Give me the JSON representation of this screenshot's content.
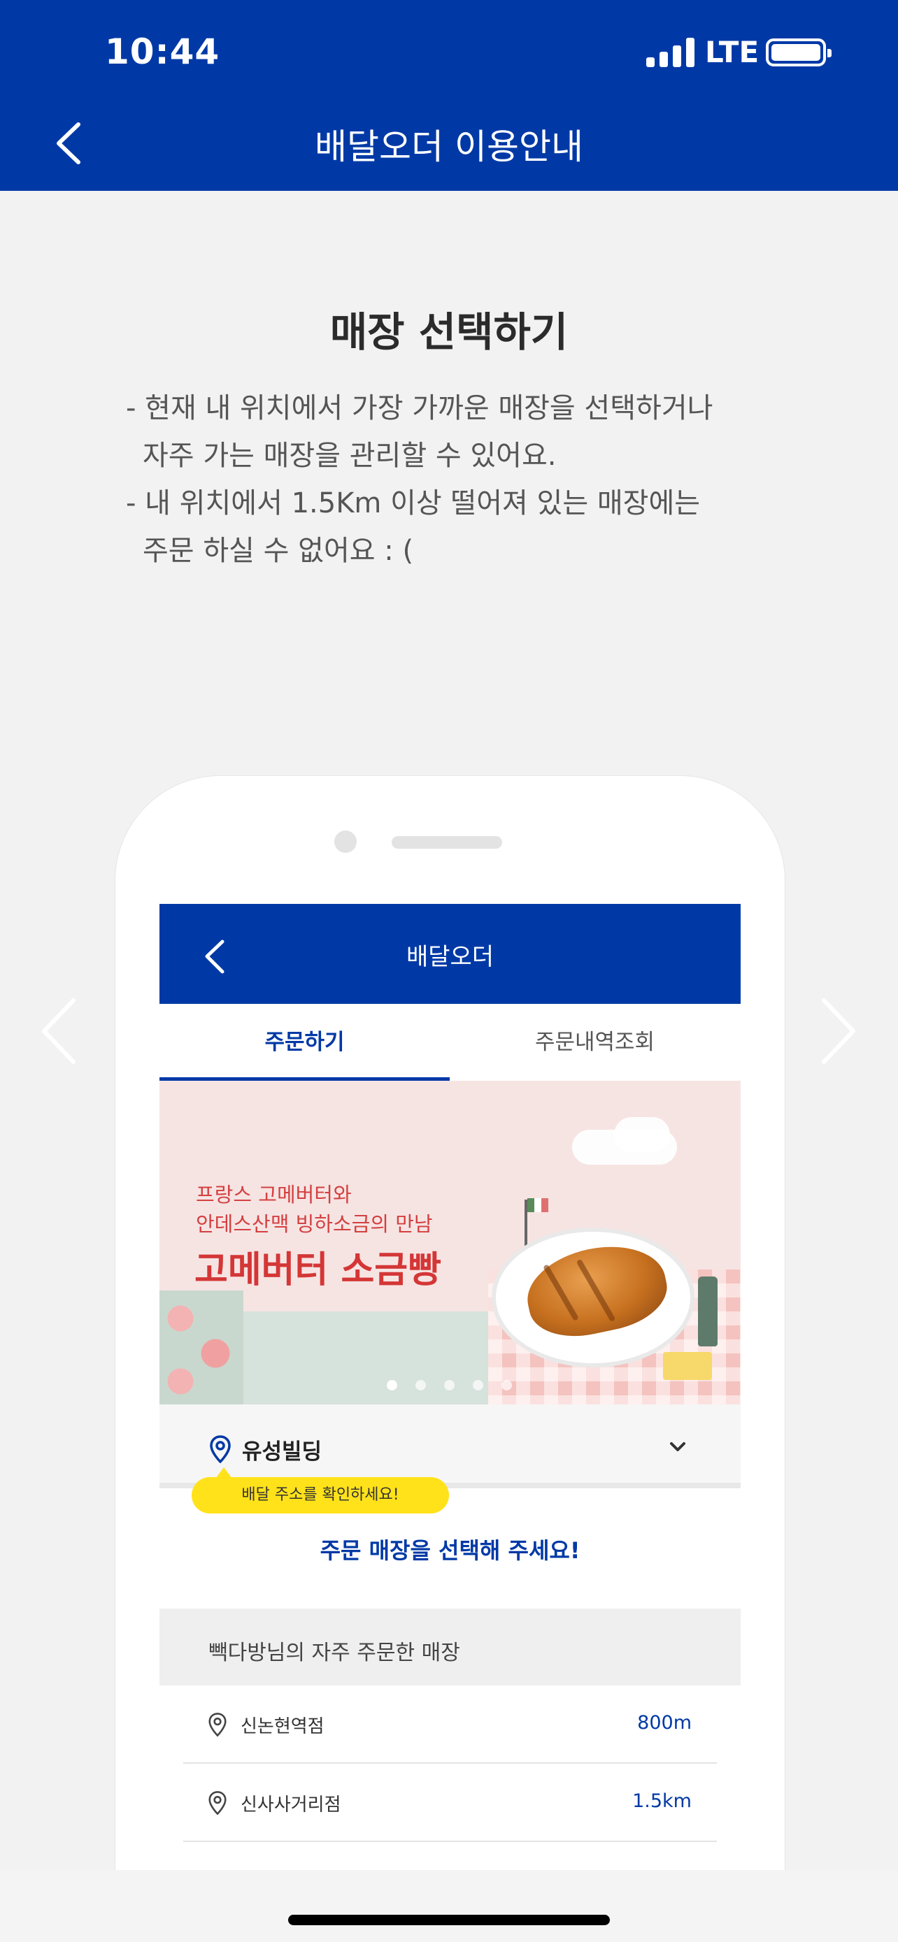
{
  "status_bar": {
    "time": "10:44",
    "network": "LTE"
  },
  "nav": {
    "title": "배달오더 이용안내"
  },
  "intro": {
    "heading": "매장 선택하기",
    "lines": [
      "- 현재 내 위치에서 가장 가까운 매장을 선택하거나",
      "자주 가는 매장을 관리할 수 있어요.",
      "- 내 위치에서 1.5Km 이상 떨어져 있는 매장에는",
      "주문 하실 수 없어요 : ("
    ]
  },
  "mockup": {
    "header_title": "배달오더",
    "tabs": [
      {
        "label": "주문하기",
        "active": true
      },
      {
        "label": "주문내역조회",
        "active": false
      }
    ],
    "banner": {
      "line1": "프랑스 고메버터와",
      "line2": "안데스산맥 빙하소금의 만남",
      "line3": "고메버터 소금빵",
      "page_count": 5,
      "active_page": 1
    },
    "location": {
      "name": "유성빌딩",
      "tooltip": "배달 주소를 확인하세요!"
    },
    "select_prompt": "주문 매장을 선택해 주세요!",
    "frequent_header": "빽다방님의 자주 주문한 매장",
    "stores": [
      {
        "name": "신논현역점",
        "distance": "800m"
      },
      {
        "name": "신사사거리점",
        "distance": "1.5km"
      }
    ]
  },
  "colors": {
    "brand": "#0039a6",
    "tooltip": "#ffe21a",
    "banner_text": "#d43636"
  },
  "icons": [
    "back-chevron-icon",
    "carousel-prev-icon",
    "carousel-next-icon",
    "location-pin-icon",
    "chevron-down-icon"
  ]
}
